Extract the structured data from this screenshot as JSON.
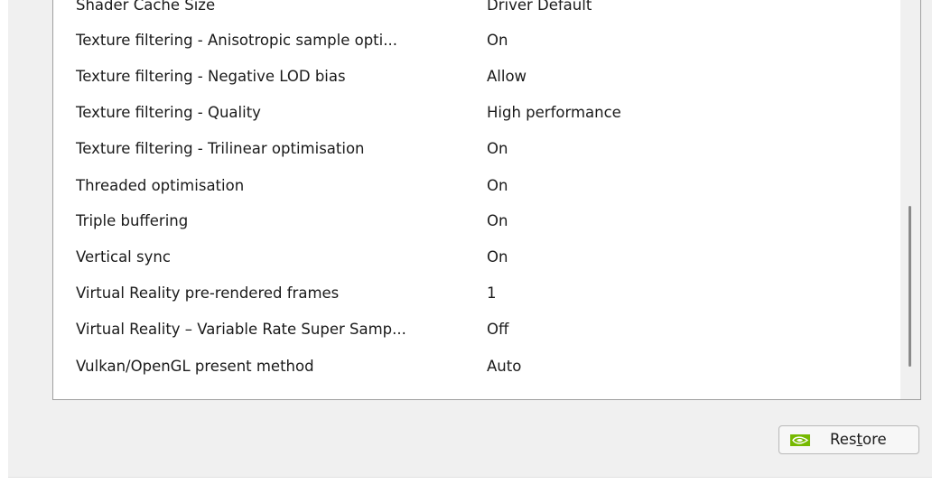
{
  "settings": [
    {
      "name": "Shader Cache Size",
      "value": "Driver Default"
    },
    {
      "name": "Texture filtering - Anisotropic sample opti...",
      "value": "On"
    },
    {
      "name": "Texture filtering - Negative LOD bias",
      "value": "Allow"
    },
    {
      "name": "Texture filtering - Quality",
      "value": "High performance"
    },
    {
      "name": "Texture filtering - Trilinear optimisation",
      "value": "On"
    },
    {
      "name": "Threaded optimisation",
      "value": "On"
    },
    {
      "name": "Triple buffering",
      "value": "On"
    },
    {
      "name": "Vertical sync",
      "value": "On"
    },
    {
      "name": "Virtual Reality pre-rendered frames",
      "value": "1"
    },
    {
      "name": "Virtual Reality – Variable Rate Super Samp...",
      "value": "Off"
    },
    {
      "name": "Vulkan/OpenGL present method",
      "value": "Auto"
    }
  ],
  "restore_button": {
    "label_pre": "Res",
    "label_accel": "t",
    "label_post": "ore",
    "icon": "nvidia-logo-icon"
  },
  "colors": {
    "nvidia_green": "#76b900"
  }
}
